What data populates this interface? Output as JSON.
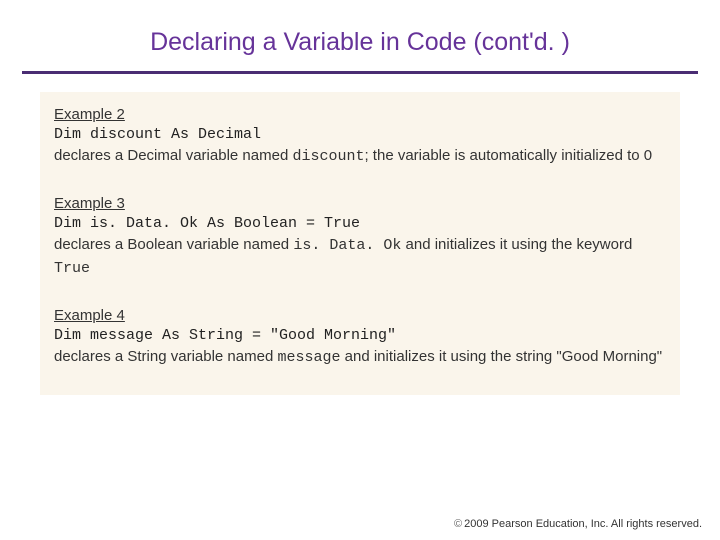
{
  "title": "Declaring a Variable in Code (cont'd. )",
  "examples": [
    {
      "heading": "Example 2",
      "code": "Dim discount As Decimal",
      "desc_pre": "declares a Decimal variable named ",
      "desc_mono": "discount",
      "desc_post": "; the variable is automatically initialized to 0"
    },
    {
      "heading": "Example 3",
      "code": "Dim is. Data. Ok As Boolean = True",
      "desc_pre": "declares a Boolean variable named ",
      "desc_mono": "is. Data. Ok",
      "desc_mid": " and initializes it using the keyword ",
      "desc_mono2": "True",
      "desc_post": ""
    },
    {
      "heading": "Example 4",
      "code": "Dim message As String = \"Good Morning\"",
      "desc_pre": "declares a String variable named ",
      "desc_mono": "message",
      "desc_post": " and initializes it using the string \"Good Morning\""
    }
  ],
  "footer": {
    "symbol": "©",
    "text": "2009 Pearson Education, Inc.  All rights reserved."
  }
}
